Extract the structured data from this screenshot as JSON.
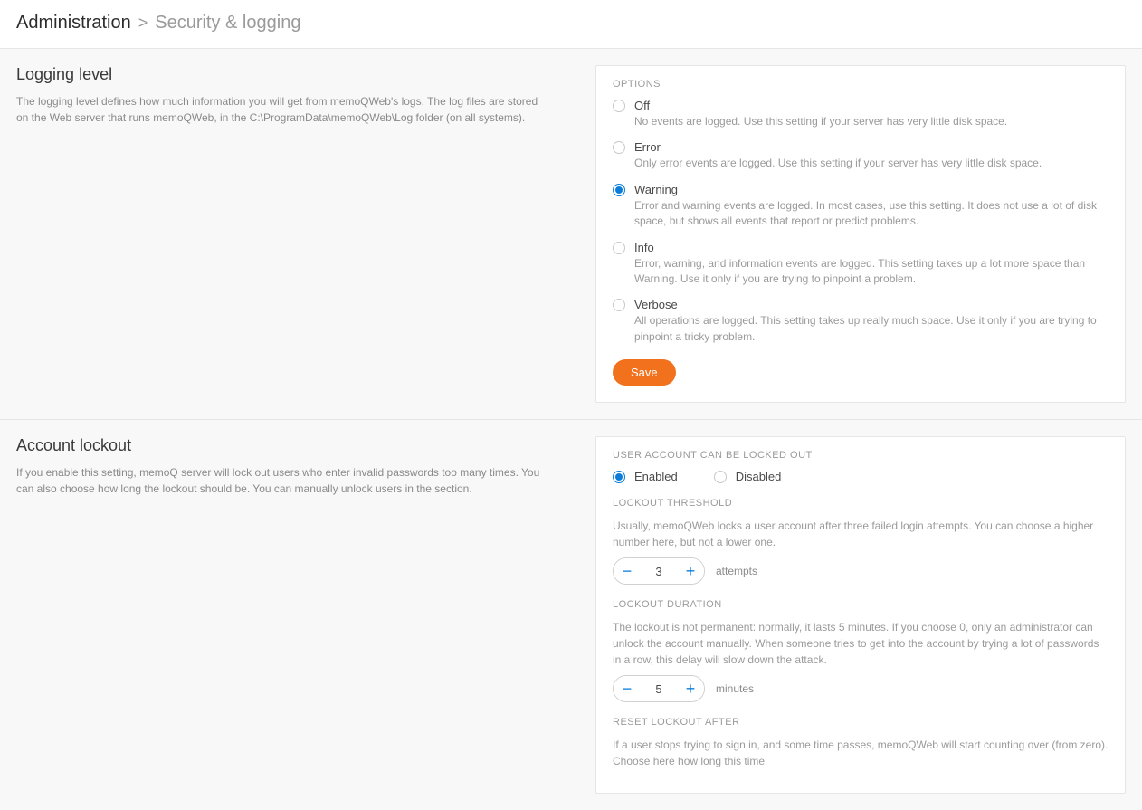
{
  "breadcrumb": {
    "root": "Administration",
    "separator": ">",
    "leaf": "Security & logging"
  },
  "logging": {
    "title": "Logging level",
    "desc": "The logging level defines how much information you will get from memoQWeb's logs. The log files are stored on the Web server that runs memoQWeb, in the C:\\ProgramData\\memoQWeb\\Log folder (on all systems).",
    "options_label": "OPTIONS",
    "options": [
      {
        "label": "Off",
        "desc": "No events are logged. Use this setting if your server has very little disk space.",
        "selected": false
      },
      {
        "label": "Error",
        "desc": "Only error events are logged. Use this setting if your server has very little disk space.",
        "selected": false
      },
      {
        "label": "Warning",
        "desc": "Error and warning events are logged. In most cases, use this setting. It does not use a lot of disk space, but shows all events that report or predict problems.",
        "selected": true
      },
      {
        "label": "Info",
        "desc": "Error, warning, and information events are logged. This setting takes up a lot more space than Warning. Use it only if you are trying to pinpoint a problem.",
        "selected": false
      },
      {
        "label": "Verbose",
        "desc": "All operations are logged. This setting takes up really much space. Use it only if you are trying to pinpoint a tricky problem.",
        "selected": false
      }
    ],
    "save_label": "Save"
  },
  "lockout": {
    "title": "Account lockout",
    "desc": "If you enable this setting, memoQ server will lock out users who enter invalid passwords too many times. You can also choose how long the lockout should be. You can manually unlock users in the  section.",
    "enable_label": "USER ACCOUNT CAN BE LOCKED OUT",
    "enabled_label": "Enabled",
    "disabled_label": "Disabled",
    "enabled_selected": true,
    "threshold_label": "LOCKOUT THRESHOLD",
    "threshold_desc": "Usually, memoQWeb locks a user account after three failed login attempts. You can choose a higher number here, but not a lower one.",
    "threshold_value": "3",
    "threshold_unit": "attempts",
    "duration_label": "LOCKOUT DURATION",
    "duration_desc": "The lockout is not permanent: normally, it lasts 5 minutes. If you choose 0, only an administrator can unlock the account manually. When someone tries to get into the account by trying a lot of passwords in a row, this delay will slow down the attack.",
    "duration_value": "5",
    "duration_unit": "minutes",
    "reset_label": "RESET LOCKOUT AFTER",
    "reset_desc": "If a user stops trying to sign in, and some time passes, memoQWeb will start counting over (from zero). Choose here how long this time"
  }
}
